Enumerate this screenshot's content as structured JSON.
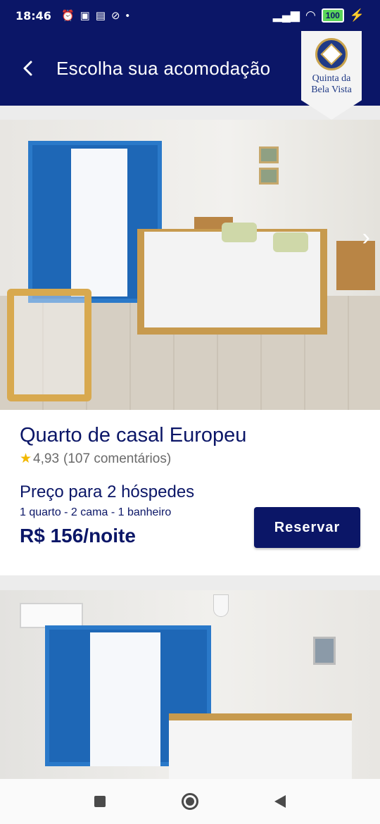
{
  "status_bar": {
    "time": "18:46",
    "battery": "100",
    "icons": [
      "alarm-icon",
      "linkedin-icon",
      "bus-icon",
      "do-not-disturb-icon",
      "dot-icon",
      "signal-icon",
      "signal-icon",
      "wifi-icon",
      "battery-icon",
      "charging-icon"
    ]
  },
  "header": {
    "title": "Escolha sua acomodação",
    "logo_text_line1": "Quinta da",
    "logo_text_line2": "Bela Vista"
  },
  "rooms": [
    {
      "name": "Quarto de casal Europeu",
      "rating": "4,93",
      "reviews": "(107 comentários)",
      "price_for": "Preço para 2 hóspedes",
      "details": "1 quarto - 2 cama - 1 banheiro",
      "price": "R$ 156/noite",
      "reserve_label": "Reservar"
    }
  ],
  "colors": {
    "brand": "#0b1667",
    "star": "#f2b800",
    "gold": "#c9a34d"
  }
}
